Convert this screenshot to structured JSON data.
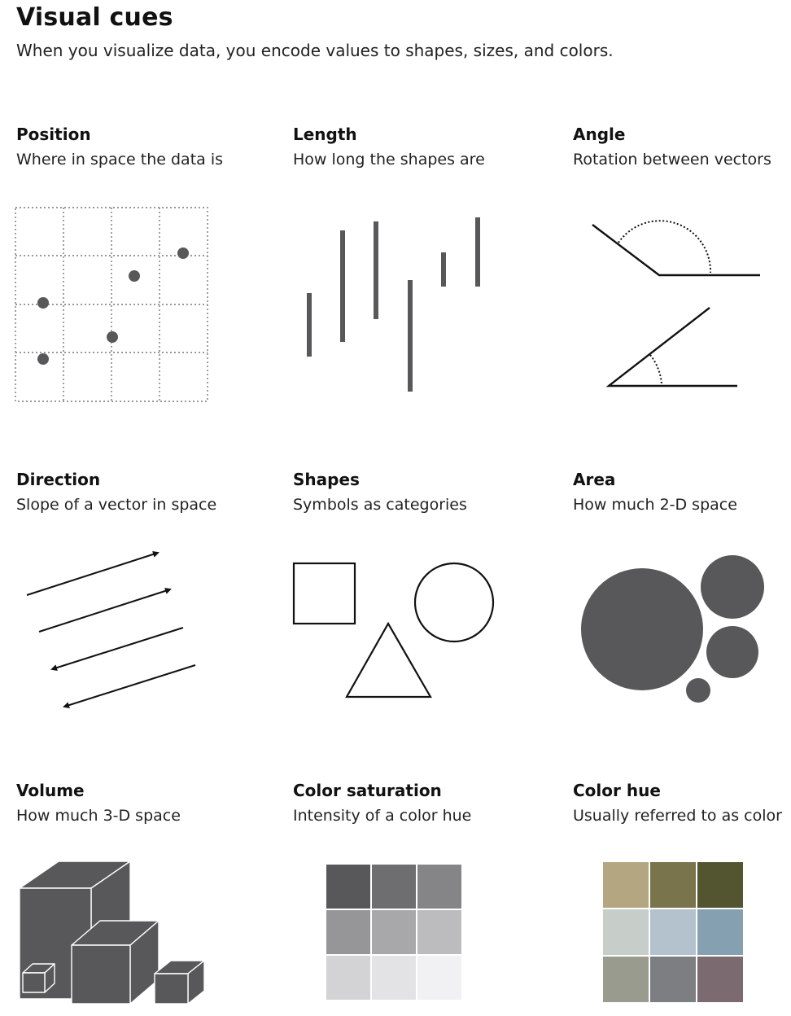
{
  "header": {
    "title": "Visual cues",
    "subtitle": "When you visualize data, you encode values to shapes, sizes, and colors."
  },
  "cues": [
    {
      "title": "Position",
      "description": "Where in space the data is"
    },
    {
      "title": "Length",
      "description": "How long the shapes are"
    },
    {
      "title": "Angle",
      "description": "Rotation between vectors"
    },
    {
      "title": "Direction",
      "description": "Slope of a vector in space"
    },
    {
      "title": "Shapes",
      "description": "Symbols as categories"
    },
    {
      "title": "Area",
      "description": "How much 2-D space"
    },
    {
      "title": "Volume",
      "description": "How much 3-D space"
    },
    {
      "title": "Color saturation",
      "description": "Intensity of a color hue"
    },
    {
      "title": "Color hue",
      "description": "Usually referred to as color"
    }
  ],
  "colors": {
    "mark": "#58585a",
    "saturation_swatches": [
      "#58585a",
      "#6e6e70",
      "#858587",
      "#969698",
      "#a8a8aa",
      "#bcbcbe",
      "#d3d3d5",
      "#e3e3e5",
      "#f1f1f3"
    ],
    "hue_swatches": [
      "#b3a680",
      "#7a744c",
      "#535530",
      "#c7cdc8",
      "#b3c2cc",
      "#85a0b0",
      "#999b8f",
      "#7d7e82",
      "#7b6a70"
    ]
  }
}
